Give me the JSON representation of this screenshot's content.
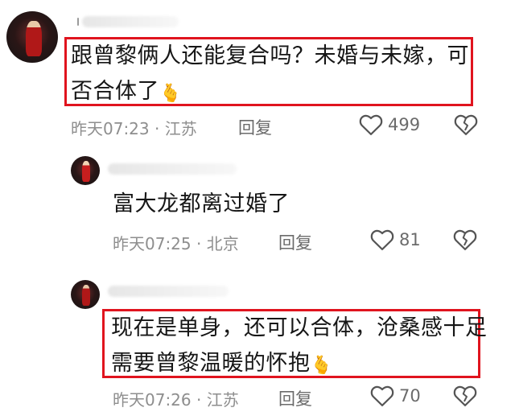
{
  "comments": [
    {
      "text_line1": "跟曾黎俩人还能复合吗？未婚与未嫁，可",
      "text_line2": "否合体了",
      "emoji": "🫰",
      "time": "昨天07:23",
      "separator": "·",
      "location": "江苏",
      "reply_label": "回复",
      "likes": "499",
      "is_reply": false
    },
    {
      "text_line1": "富大龙都离过婚了",
      "time": "昨天07:25",
      "separator": "·",
      "location": "北京",
      "reply_label": "回复",
      "likes": "81",
      "is_reply": true
    },
    {
      "text_line1": "现在是单身，还可以合体，沧桑感十足",
      "text_line2": "需要曾黎温暖的怀抱",
      "emoji": "🫰",
      "time": "昨天07:26",
      "separator": "·",
      "location": "江苏",
      "reply_label": "回复",
      "likes": "70",
      "is_reply": true
    }
  ],
  "icons": {
    "like": "heart-outline-icon",
    "dislike": "broken-heart-icon"
  },
  "colors": {
    "highlight": "#e0141e",
    "meta_text": "#8e8e8e",
    "body_text": "#161616"
  }
}
